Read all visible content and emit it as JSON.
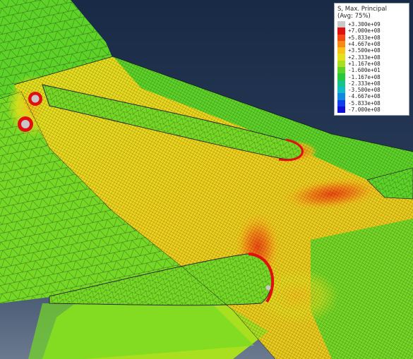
{
  "legend": {
    "title_line1": "S, Max. Principal",
    "title_line2": "(Avg: 75%)",
    "entries": [
      {
        "label": "+3.300e+09",
        "color": "#c8c8c8"
      },
      {
        "label": "+7.000e+08",
        "color": "#e01010"
      },
      {
        "label": "+5.833e+08",
        "color": "#f24a10"
      },
      {
        "label": "+4.667e+08",
        "color": "#f78a15"
      },
      {
        "label": "+3.500e+08",
        "color": "#f7c21a"
      },
      {
        "label": "+2.333e+08",
        "color": "#e3e21c"
      },
      {
        "label": "+1.167e+08",
        "color": "#a8e020"
      },
      {
        "label": "-1.600e+01",
        "color": "#5cd326"
      },
      {
        "label": "-1.167e+08",
        "color": "#26c83c"
      },
      {
        "label": "-2.333e+08",
        "color": "#14c48a"
      },
      {
        "label": "-3.500e+08",
        "color": "#10bcc8"
      },
      {
        "label": "-4.667e+08",
        "color": "#1088e0"
      },
      {
        "label": "-5.833e+08",
        "color": "#1040ec"
      },
      {
        "label": "-7.000e+08",
        "color": "#1010d8"
      }
    ]
  }
}
